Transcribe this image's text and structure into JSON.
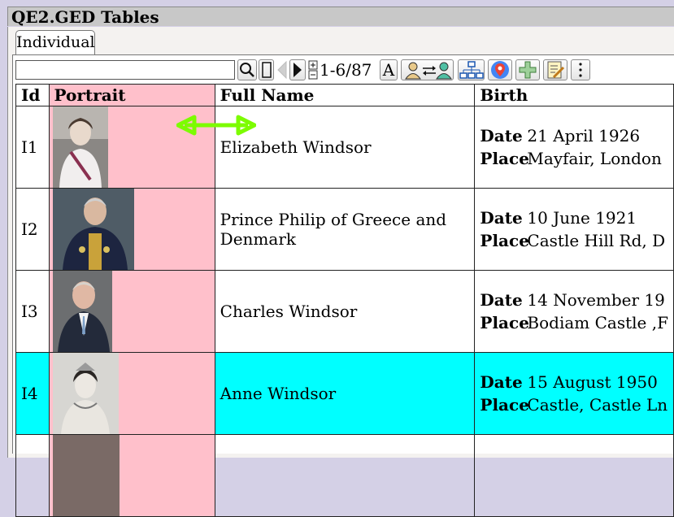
{
  "window": {
    "title": "QE2.GED Tables"
  },
  "tabs": [
    {
      "label": "Individual"
    }
  ],
  "toolbar": {
    "search_value": "",
    "page_label": "1-6/87",
    "font_button_label": "A"
  },
  "table": {
    "headers": {
      "id": "Id",
      "portrait": "Portrait",
      "name": "Full Name",
      "birth": "Birth"
    },
    "birth_labels": {
      "date": "Date",
      "place": "Place"
    },
    "rows": [
      {
        "id": "I1",
        "name": "Elizabeth Windsor",
        "date": "21 April 1926",
        "place": "Mayfair, London",
        "selected": false
      },
      {
        "id": "I2",
        "name": "Prince Philip of Greece and Denmark",
        "date": "10 June 1921",
        "place": "Castle Hill Rd, D",
        "selected": false
      },
      {
        "id": "I3",
        "name": "Charles Windsor",
        "date": "14 November 19",
        "place": "Bodiam Castle ,F",
        "selected": false
      },
      {
        "id": "I4",
        "name": "Anne Windsor",
        "date": "15 August 1950",
        "place": "Castle, Castle Ln",
        "selected": true
      }
    ]
  },
  "colors": {
    "portrait_column": "#ffc0cb",
    "selected_row": "#00ffff",
    "resize_arrow": "#7cfc00"
  }
}
